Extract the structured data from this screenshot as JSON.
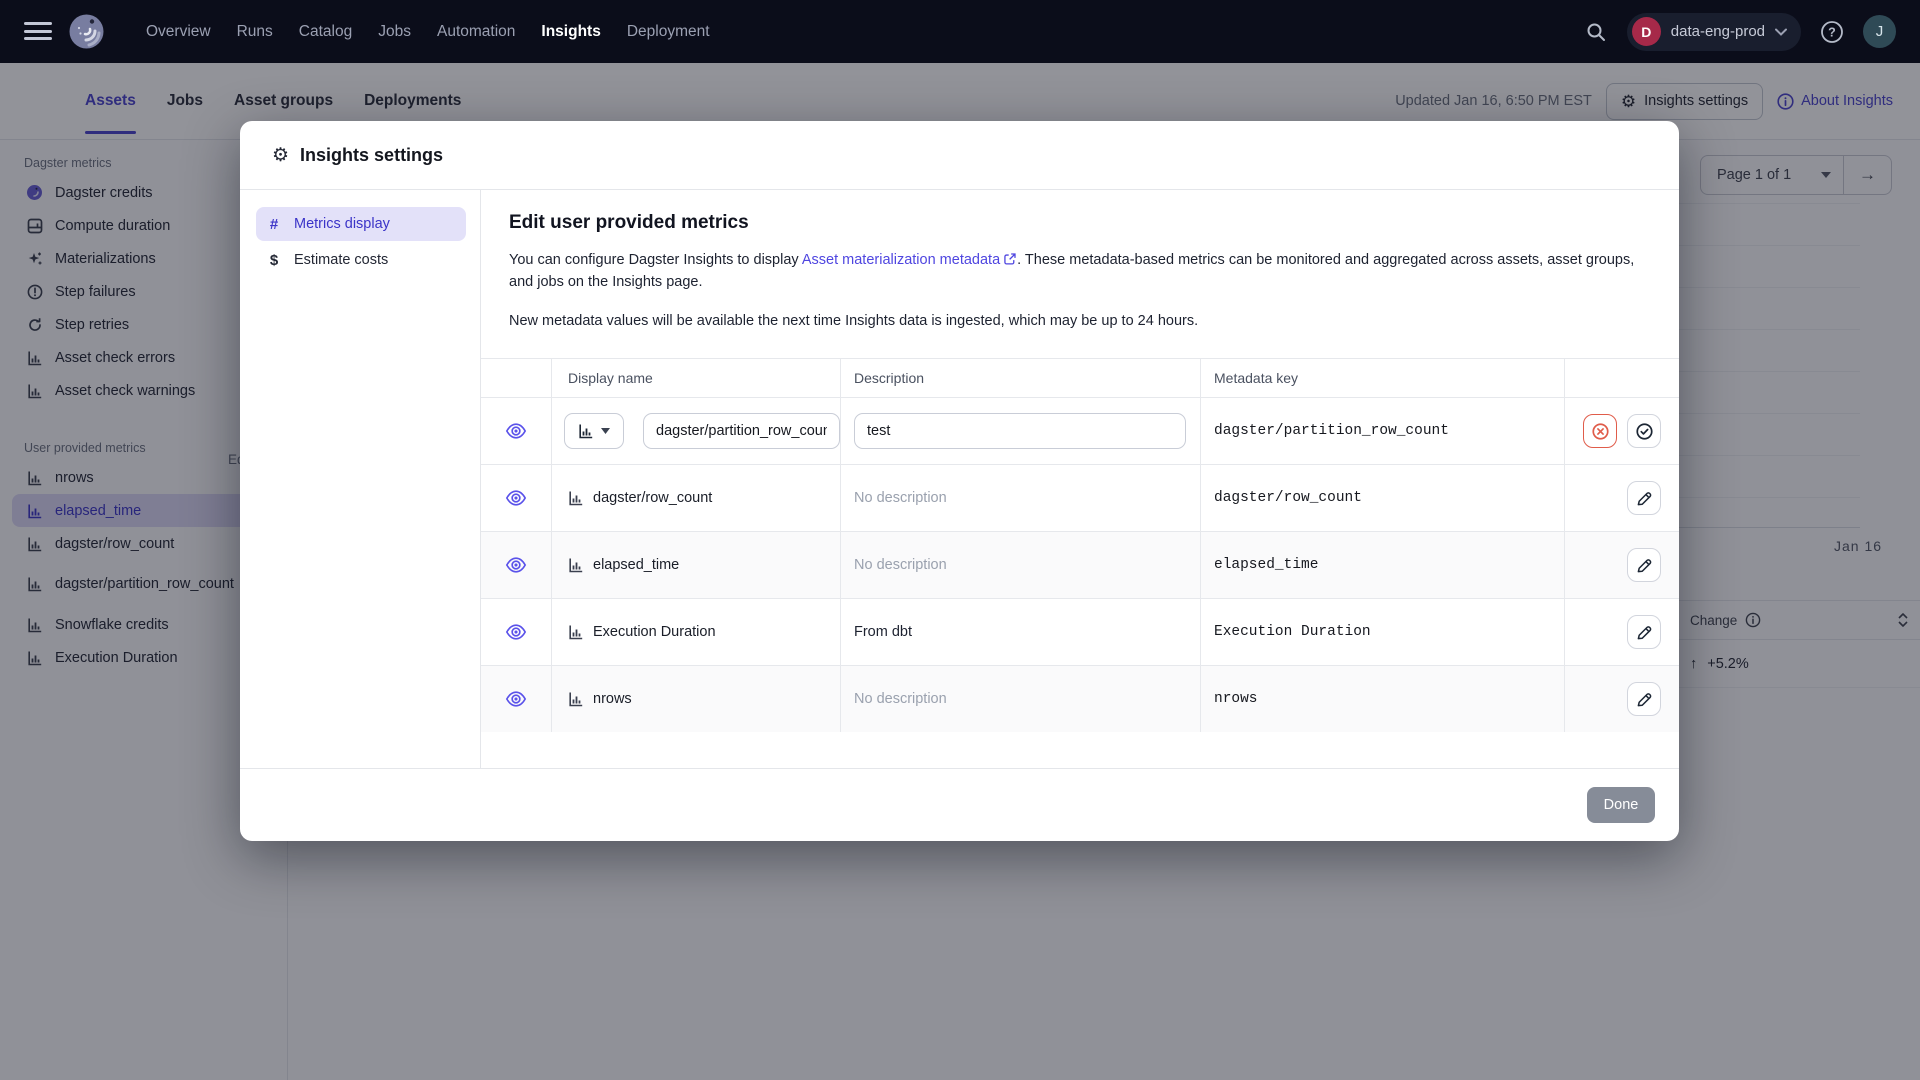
{
  "topnav": {
    "items": [
      "Overview",
      "Runs",
      "Catalog",
      "Jobs",
      "Automation",
      "Insights",
      "Deployment"
    ],
    "active": "Insights",
    "org_badge": "D",
    "org_name": "data-eng-prod",
    "avatar_initial": "J"
  },
  "subnav": {
    "tabs": [
      "Assets",
      "Jobs",
      "Asset groups",
      "Deployments"
    ],
    "active": "Assets",
    "updated": "Updated Jan 16, 6:50 PM EST",
    "settings_button": "Insights settings",
    "about_link": "About Insights"
  },
  "sidebar": {
    "dagster_section": "Dagster metrics",
    "dagster_items": [
      "Dagster credits",
      "Compute duration",
      "Materializations",
      "Step failures",
      "Step retries",
      "Asset check errors",
      "Asset check warnings"
    ],
    "user_section": "User provided metrics",
    "user_edit": "Edit",
    "user_items": [
      "nrows",
      "elapsed_time",
      "dagster/row_count",
      "dagster/partition_row_count",
      "Snowflake credits",
      "Execution Duration"
    ],
    "selected_item": "elapsed_time"
  },
  "background_page": {
    "pagination": "Page 1 of 1",
    "date_tick": "Jan 16",
    "change_header": "Change",
    "change_arrow": "↑",
    "change_value": "+5.2%",
    "pager_arrow": "→"
  },
  "modal": {
    "title": "Insights settings",
    "nav": [
      {
        "glyph": "#",
        "label": "Metrics display",
        "selected": true
      },
      {
        "glyph": "$",
        "label": "Estimate costs",
        "selected": false
      }
    ],
    "heading": "Edit user provided metrics",
    "intro_pre": "You can configure Dagster Insights to display ",
    "intro_link": "Asset materialization metadata",
    "intro_post": ". These metadata-based metrics can be monitored and aggregated across assets, asset groups, and jobs on the Insights page.",
    "note": "New metadata values will be available the next time Insights data is ingested, which may be up to 24 hours.",
    "table": {
      "headers": [
        "Display name",
        "Description",
        "Metadata key"
      ],
      "rows": [
        {
          "name_input": "dagster/partition_row_count",
          "description_input": "test",
          "key": "dagster/partition_row_count",
          "state": "editing"
        },
        {
          "name": "dagster/row_count",
          "description": "No description",
          "key": "dagster/row_count",
          "placeholder": true
        },
        {
          "name": "elapsed_time",
          "description": "No description",
          "key": "elapsed_time",
          "placeholder": true
        },
        {
          "name": "Execution Duration",
          "description": "From dbt",
          "key": "Execution Duration",
          "placeholder": false
        },
        {
          "name": "nrows",
          "description": "No description",
          "key": "nrows",
          "placeholder": true
        }
      ]
    },
    "done_button": "Done"
  },
  "colors": {
    "topnav_bg": "#0b0d1a",
    "accent_indigo": "#4a43ce",
    "link_indigo": "#4f46e0",
    "eye_icon": "#5a52ea",
    "danger_red": "#e05c4a",
    "selected_pill": "#e3e1f9",
    "done_button_bg": "#868c98",
    "org_badge_bg": "#a62949",
    "avatar_bg": "#2f4a56"
  }
}
